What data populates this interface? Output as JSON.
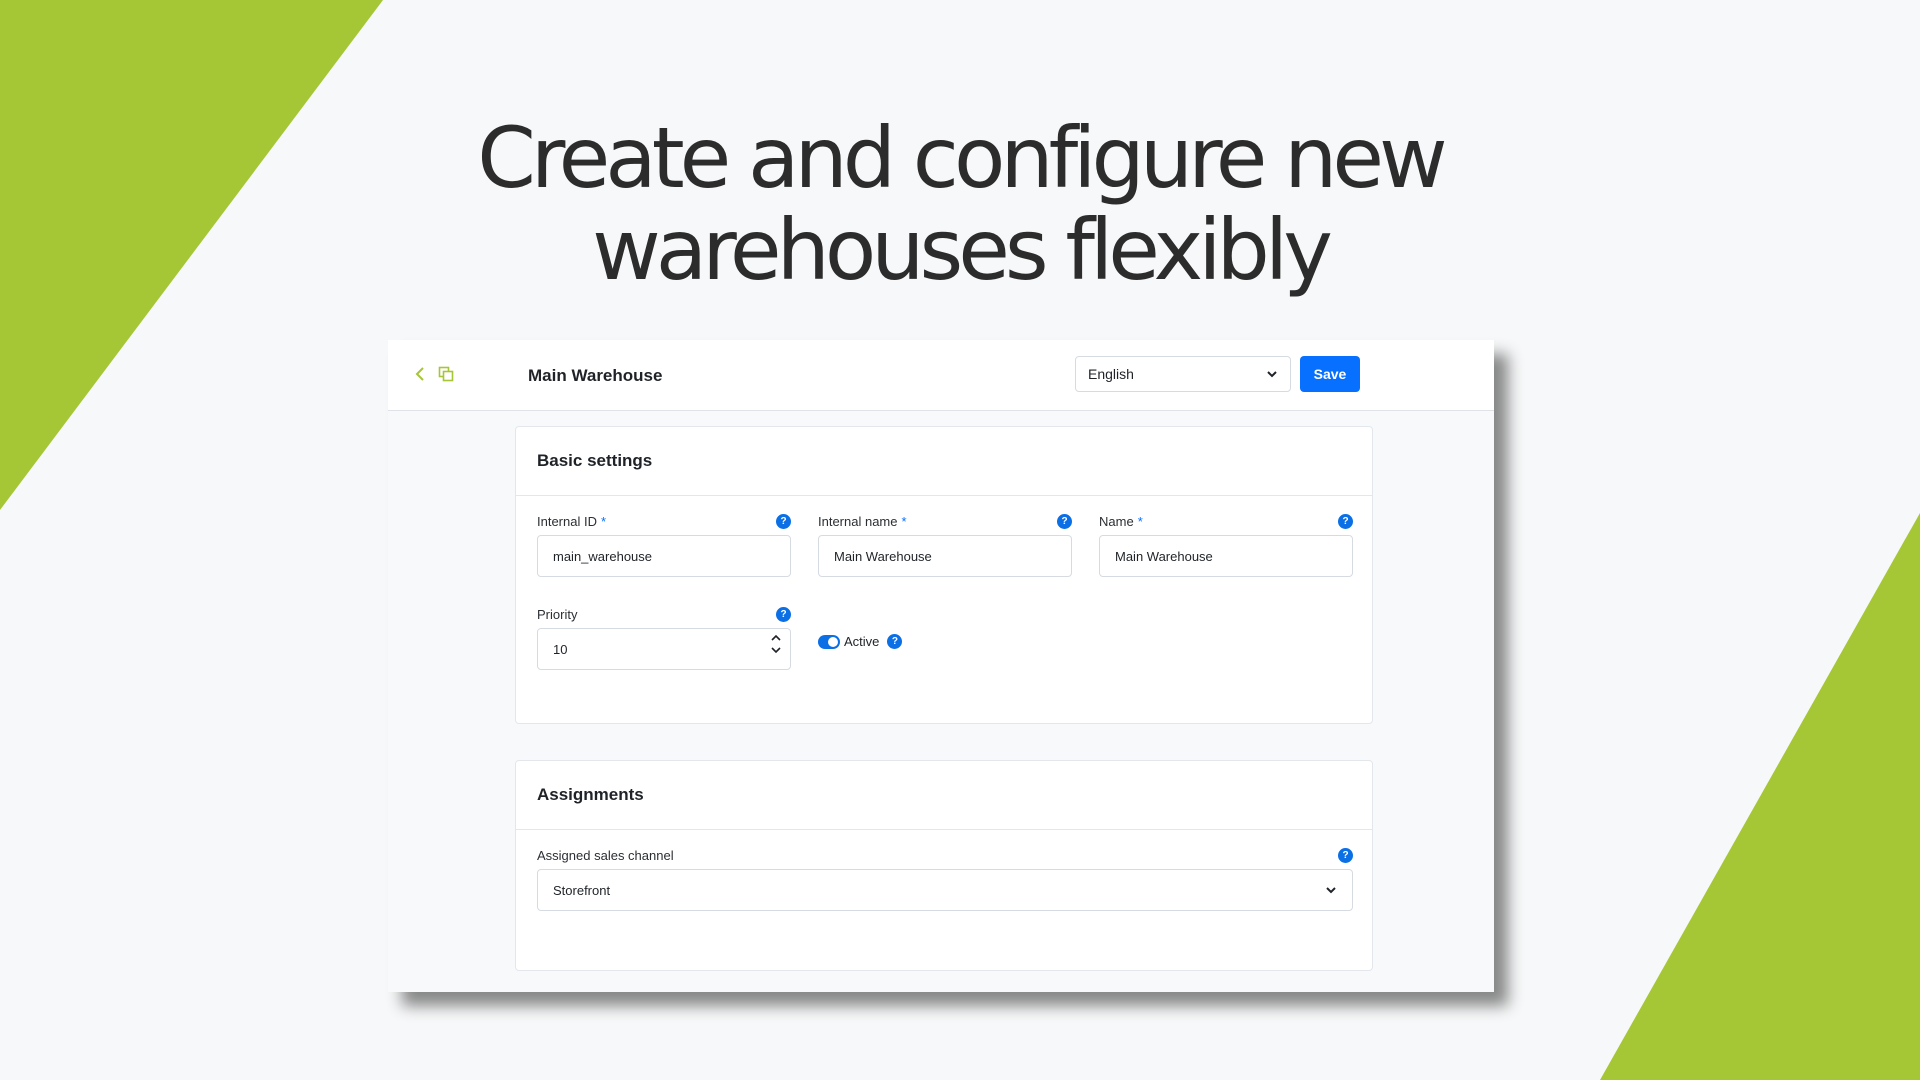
{
  "headline": {
    "line1": "Create and configure new",
    "line2": "warehouses flexibly"
  },
  "colors": {
    "accent_green": "#a5c635",
    "primary_blue": "#0870ff"
  },
  "window": {
    "title": "Main Warehouse",
    "icons": {
      "back": "chevron-left-icon",
      "duplicate": "copy-icon"
    },
    "language": {
      "selected": "English"
    },
    "save_label": "Save"
  },
  "basic_settings": {
    "heading": "Basic settings",
    "internal_id": {
      "label": "Internal ID",
      "required": "*",
      "value": "main_warehouse"
    },
    "internal_name": {
      "label": "Internal name",
      "required": "*",
      "value": "Main Warehouse"
    },
    "name": {
      "label": "Name",
      "required": "*",
      "value": "Main Warehouse"
    },
    "priority": {
      "label": "Priority",
      "value": "10"
    },
    "active": {
      "label": "Active",
      "checked": true
    },
    "help_glyph": "?"
  },
  "assignments": {
    "heading": "Assignments",
    "sales_channel": {
      "label": "Assigned sales channel",
      "selected": "Storefront"
    }
  }
}
